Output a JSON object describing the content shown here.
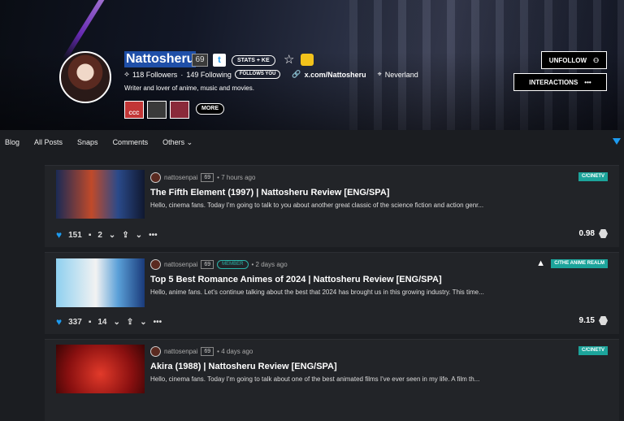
{
  "profile": {
    "name": "Nattosheru",
    "reputation": "69",
    "stats_label": "STATS + KE",
    "followers": "118 Followers",
    "following": "149 Following",
    "follows_you": "FOLLOWS YOU",
    "website": "x.com/Nattosheru",
    "location": "Neverland",
    "bio": "Writer and lover of anime, music and movies.",
    "community_label": "CCC",
    "more_label": "MORE",
    "unfollow_label": "UNFOLLOW",
    "interactions_label": "INTERACTIONS",
    "interactions_more": "•••"
  },
  "nav": {
    "tabs": [
      "Blog",
      "All Posts",
      "Snaps",
      "Comments",
      "Others ⌄"
    ]
  },
  "posts": [
    {
      "author": "nattosenpai",
      "rep": "69",
      "member": "",
      "time": "• 7 hours ago",
      "community": "C/CINETV",
      "title": "The Fifth Element (1997) | Nattosheru Review [ENG/SPA]",
      "excerpt": "Hello, cinema fans. Today I'm going to talk to you about another great classic of the science fiction and action genr...",
      "votes": "151",
      "comments": "2",
      "payout": "0.98"
    },
    {
      "author": "nattosenpai",
      "rep": "69",
      "member": "MEMBER",
      "time": "• 2 days ago",
      "community": "C/THE ANIME REALM",
      "title": "Top 5 Best Romance Animes of 2024 | Nattosheru Review [ENG/SPA]",
      "excerpt": "Hello, anime fans. Let's continue talking about the best that 2024 has brought us in this growing industry. This time...",
      "votes": "337",
      "comments": "14",
      "payout": "9.15"
    },
    {
      "author": "nattosenpai",
      "rep": "69",
      "member": "",
      "time": "• 4 days ago",
      "community": "C/CINETV",
      "title": "Akira (1988) | Nattosheru Review [ENG/SPA]",
      "excerpt": "Hello, cinema fans. Today I'm going to talk about one of the best animated films I've ever seen in my life. A film th...",
      "votes": "",
      "comments": "",
      "payout": ""
    }
  ],
  "colors": {
    "accent": "#1d9bf0",
    "community_tag": "#1ca49b",
    "name_highlight": "#1f4fa8"
  }
}
